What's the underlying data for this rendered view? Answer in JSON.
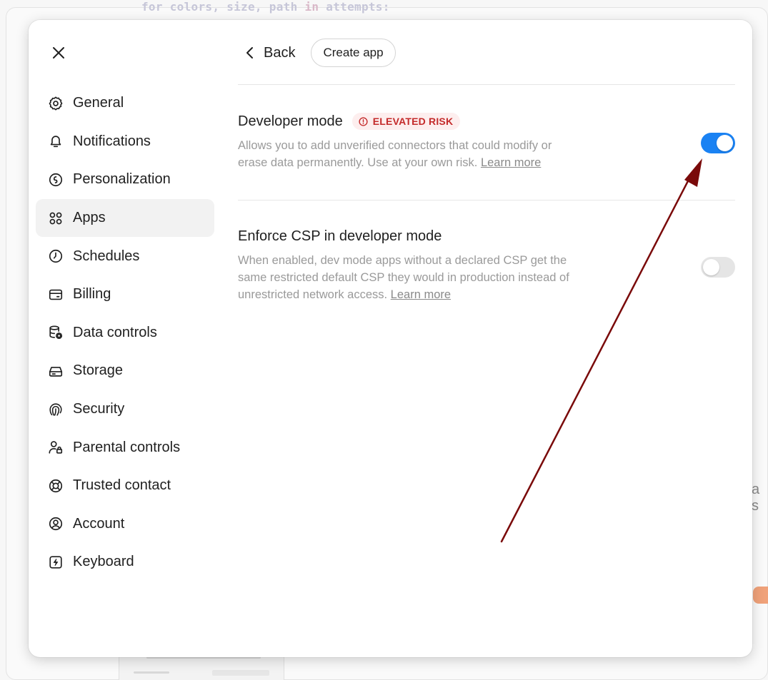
{
  "background": {
    "code_line_prefix": "for colors, size, path ",
    "code_line_kw": "in",
    "code_line_suffix": " attempts:",
    "right_text": "a s"
  },
  "sidebar": {
    "items": [
      {
        "label": "General",
        "icon": "gear-icon"
      },
      {
        "label": "Notifications",
        "icon": "bell-icon"
      },
      {
        "label": "Personalization",
        "icon": "personalization-icon"
      },
      {
        "label": "Apps",
        "icon": "apps-icon",
        "active": true
      },
      {
        "label": "Schedules",
        "icon": "clock-icon"
      },
      {
        "label": "Billing",
        "icon": "credit-card-icon"
      },
      {
        "label": "Data controls",
        "icon": "database-gear-icon"
      },
      {
        "label": "Storage",
        "icon": "storage-drive-icon"
      },
      {
        "label": "Security",
        "icon": "fingerprint-icon"
      },
      {
        "label": "Parental controls",
        "icon": "person-lock-icon"
      },
      {
        "label": "Trusted contact",
        "icon": "lifebuoy-icon"
      },
      {
        "label": "Account",
        "icon": "account-circle-icon"
      },
      {
        "label": "Keyboard",
        "icon": "keyboard-bolt-icon"
      }
    ]
  },
  "topbar": {
    "back_label": "Back",
    "create_app_label": "Create app"
  },
  "settings": {
    "developer_mode": {
      "title": "Developer mode",
      "badge": "ELEVATED RISK",
      "description": "Allows you to add unverified connectors that could modify or erase data permanently. Use at your own risk.",
      "link": "Learn more",
      "enabled": true
    },
    "enforce_csp": {
      "title": "Enforce CSP in developer mode",
      "description": "When enabled, dev mode apps without a declared CSP get the same restricted default CSP they would in production instead of unrestricted network access.",
      "link": "Learn more",
      "enabled": false
    }
  },
  "colors": {
    "accent": "#1a82f3",
    "risk": "#c42b2b",
    "risk_bg": "#fdeeee",
    "annotation_arrow": "#7a0a0a"
  }
}
